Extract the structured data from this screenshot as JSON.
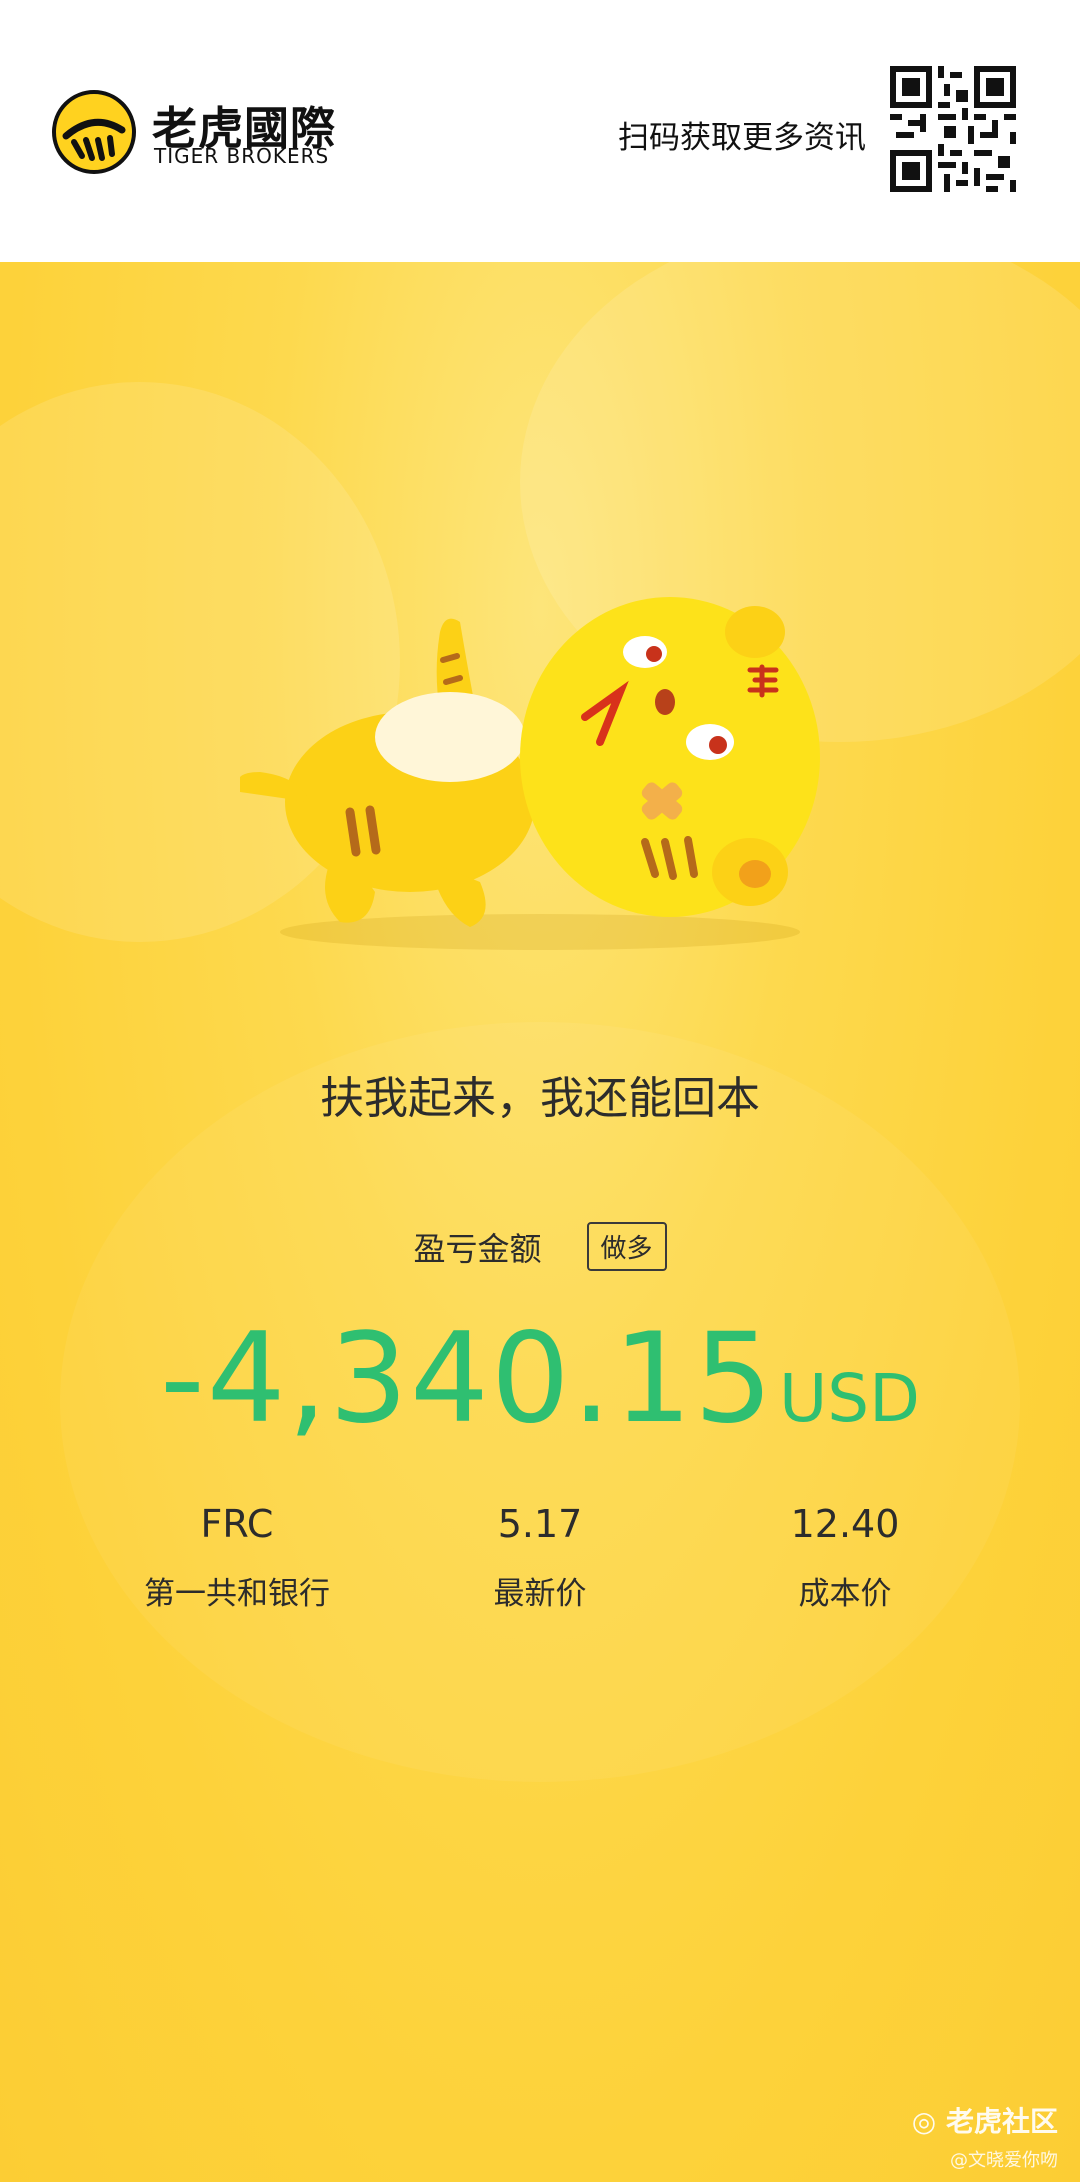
{
  "header": {
    "brand_cn": "老虎國際",
    "brand_en": "TIGER BROKERS",
    "scan_text": "扫码获取更多资讯",
    "logo_icon": "tiger-logo-icon",
    "qr_icon": "qr-code-icon"
  },
  "poster": {
    "slogan": "扶我起来，我还能回本",
    "pl_label": "盈亏金额",
    "position_badge": "做多",
    "amount_value": "-4,340.15",
    "amount_unit": "USD",
    "stats": [
      {
        "value": "FRC",
        "label": "第一共和银行"
      },
      {
        "value": "5.17",
        "label": "最新价"
      },
      {
        "value": "12.40",
        "label": "成本价"
      }
    ],
    "mascot_icon": "fallen-tiger-mascot",
    "watermark_title": "老虎社区",
    "watermark_sub": "@文晓爱你吻"
  },
  "colors": {
    "background": "#fdd43a",
    "amount": "#2fbf71",
    "text": "#2c2c2c"
  }
}
